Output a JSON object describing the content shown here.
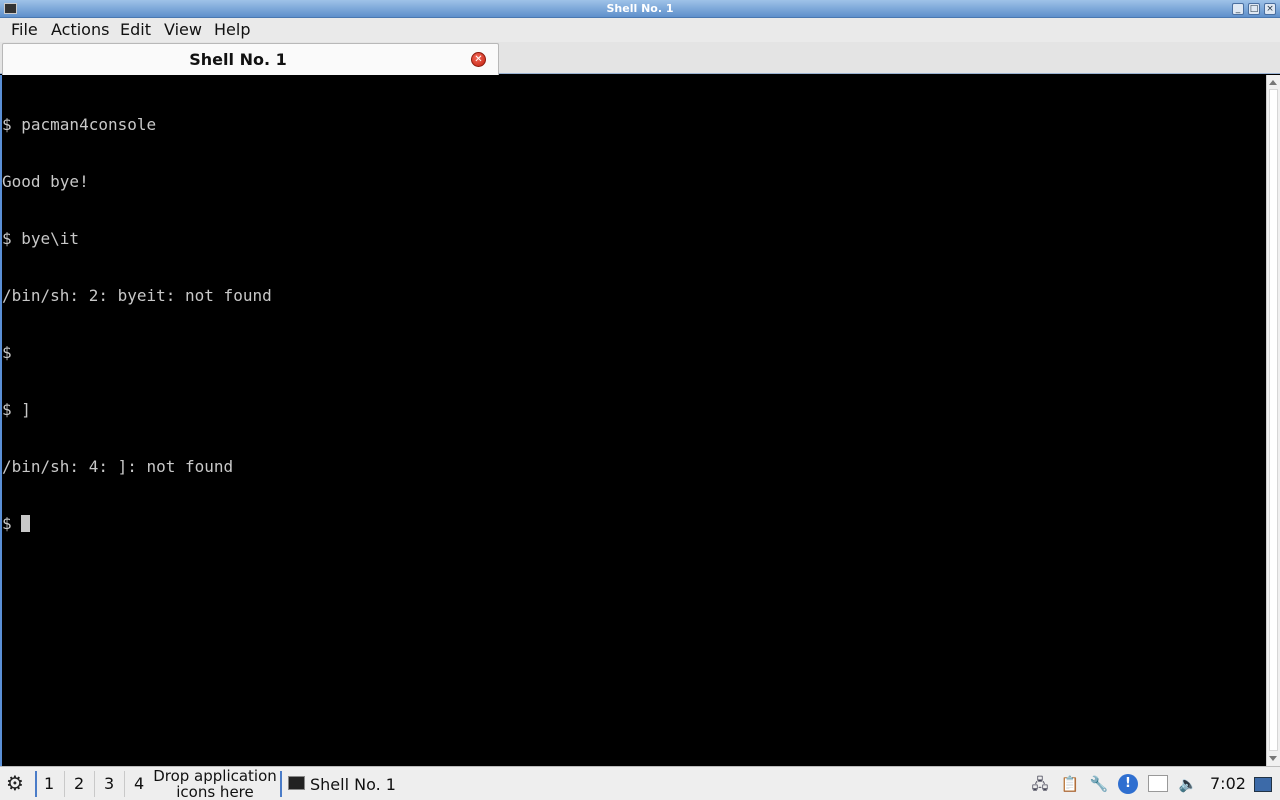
{
  "window": {
    "title": "Shell No. 1",
    "buttons": {
      "minimize": "_",
      "maximize": "□",
      "close": "×"
    }
  },
  "menubar": {
    "items": [
      "File",
      "Actions",
      "Edit",
      "View",
      "Help"
    ]
  },
  "tabs": [
    {
      "label": "Shell No. 1",
      "active": true,
      "close_icon": "close-icon"
    }
  ],
  "terminal": {
    "lines": [
      "$ pacman4console",
      "Good bye!",
      "$ bye\\it",
      "/bin/sh: 2: byeit: not found",
      "$",
      "$ ]",
      "/bin/sh: 4: ]: not found",
      "$ "
    ],
    "colors": {
      "background": "#000000",
      "foreground": "#c8c8c8"
    }
  },
  "taskbar": {
    "desktops": [
      "1",
      "2",
      "3",
      "4"
    ],
    "drop_hint": "Drop application icons here",
    "tasks": [
      {
        "label": "Shell No. 1",
        "icon": "terminal-icon"
      }
    ],
    "tray": [
      "network-icon",
      "clipboard-icon",
      "tools-icon",
      "info-icon",
      "notes-icon",
      "volume-icon"
    ],
    "clock": "7:02"
  }
}
